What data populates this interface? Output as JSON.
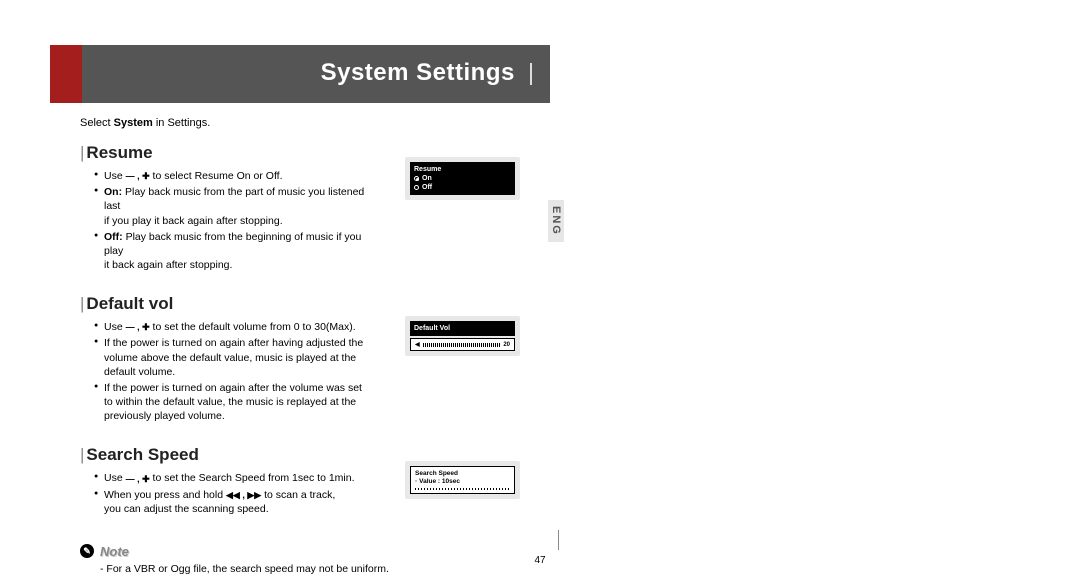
{
  "header": {
    "title": "System Settings"
  },
  "lang_tab": "ENG",
  "intro": {
    "prefix": "Select ",
    "bold": "System",
    "suffix": " in Settings."
  },
  "sections": {
    "resume": {
      "title": "Resume",
      "items": [
        {
          "prefix": "Use ",
          "icons": "— , ✚",
          "suffix": " to select Resume On or Off."
        },
        {
          "bold": "On:",
          "text": " Play back music from the part of music you listened last",
          "sub": "if you play it back again after stopping."
        },
        {
          "bold": "Off:",
          "text": " Play back music from the beginning of music if you play",
          "sub": "it back again after stopping."
        }
      ],
      "panel": {
        "title": "Resume",
        "opt_on": "On",
        "opt_off": "Off"
      }
    },
    "default_vol": {
      "title": "Default vol",
      "items": [
        {
          "prefix": "Use ",
          "icons": "— , ✚",
          "suffix": " to set the default volume from 0 to 30(Max)."
        },
        {
          "text": "If the power is turned on again after having adjusted the volume above the default value, music is played at the default volume."
        },
        {
          "text": "If the power is turned on again after the volume was set to within the default value, the music is replayed at the previously played volume."
        }
      ],
      "panel": {
        "title": "Default Vol",
        "value": "20"
      }
    },
    "search_speed": {
      "title": "Search Speed",
      "items": [
        {
          "prefix": "Use ",
          "icons": "— , ✚",
          "suffix": " to set the Search Speed from 1sec to 1min."
        },
        {
          "prefix": "When you press and hold ",
          "icons": "◀◀ , ▶▶",
          "suffix": "  to scan a track,",
          "sub": "you can  adjust the scanning speed."
        }
      ],
      "panel": {
        "line1": "Search Speed",
        "line2": "Value : 10sec"
      }
    }
  },
  "note": {
    "label": "Note",
    "text": "- For a VBR or Ogg file, the search speed may not be uniform."
  },
  "page_number": "47"
}
